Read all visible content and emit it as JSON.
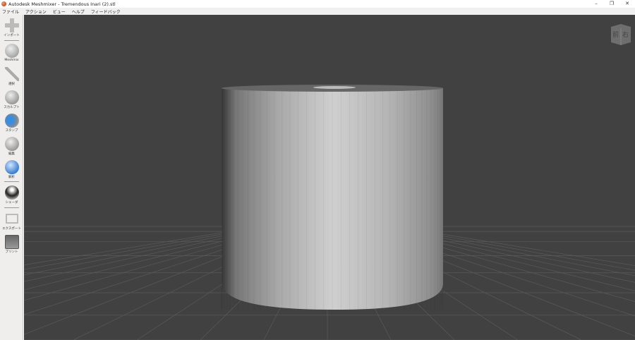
{
  "window": {
    "title": "Autodesk Meshmixer - Tremendous Inari (2).stl",
    "minimize": "–",
    "restore": "❐",
    "close": "✕"
  },
  "menu": [
    "ファイル",
    "アクション",
    "ビュー",
    "ヘルプ",
    "フィードバック"
  ],
  "tools": [
    {
      "label": "インポート",
      "icon": "plus-icon"
    },
    {
      "label": "Meshmix",
      "icon": "meshmix-icon"
    },
    {
      "label": "選択",
      "icon": "select-arrow-icon"
    },
    {
      "label": "スカルプト",
      "icon": "sculpt-brush-icon"
    },
    {
      "label": "スタンプ",
      "icon": "stamp-icon"
    },
    {
      "label": "編集",
      "icon": "edit-icon"
    },
    {
      "label": "解析",
      "icon": "analysis-icon"
    },
    {
      "label": "シェーダ",
      "icon": "shader-sphere-icon"
    },
    {
      "label": "エクスポート",
      "icon": "export-icon"
    },
    {
      "label": "プリント",
      "icon": "print-icon"
    }
  ],
  "viewcube": {
    "front": "前",
    "right": "右"
  }
}
